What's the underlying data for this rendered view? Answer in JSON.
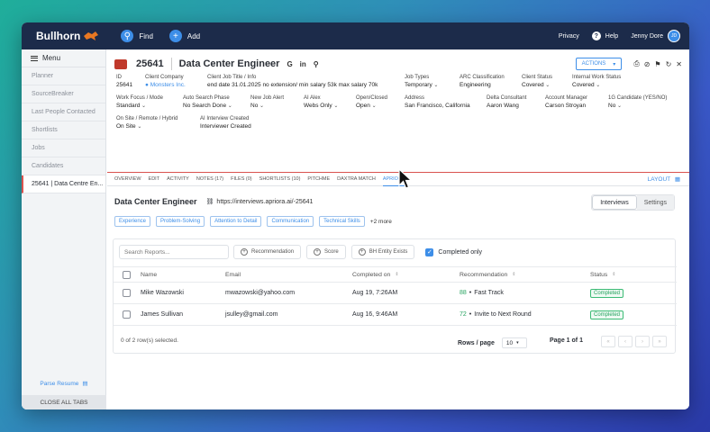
{
  "topbar": {
    "brand": "Bullhorn",
    "find": "Find",
    "add": "Add",
    "privacy": "Privacy",
    "help": "Help",
    "user": "Jenny Dore",
    "user_initials": "JD"
  },
  "sidebar": {
    "menu_label": "Menu",
    "items": [
      {
        "label": "Planner"
      },
      {
        "label": "SourceBreaker"
      },
      {
        "label": "Last People Contacted"
      },
      {
        "label": "Shortlists"
      },
      {
        "label": "Jobs"
      },
      {
        "label": "Candidates"
      },
      {
        "label": "25641 | Data Centre En..."
      }
    ],
    "parse_resume": "Parse Resume",
    "close_all": "CLOSE ALL TABS"
  },
  "record": {
    "id": "25641",
    "title": "Data Center Engineer",
    "links": [
      "G",
      "in"
    ],
    "actions_label": "ACTIONS"
  },
  "fields": {
    "row1": [
      {
        "label": "ID",
        "value": "25641"
      },
      {
        "label": "Client Company",
        "value": "Monsters Inc."
      },
      {
        "label": "Client Job Title / Info",
        "value": "end date 31.01.2025 no extension/ min salary 53k max salary 70k"
      },
      {
        "label": "Job Types",
        "value": "Temporary"
      },
      {
        "label": "ARC Classification",
        "value": "Engineering"
      },
      {
        "label": "Client Status",
        "value": "Covered"
      },
      {
        "label": "Internal Work Status",
        "value": "Covered"
      }
    ],
    "row2": [
      {
        "label": "Work Focus / Mode",
        "value": "Standard"
      },
      {
        "label": "Auto Search Phase",
        "value": "No Search Done"
      },
      {
        "label": "New Job Alert",
        "value": "No"
      },
      {
        "label": "AI Alex",
        "value": "Webs Only"
      },
      {
        "label": "Open/Closed",
        "value": "Open"
      },
      {
        "label": "Address",
        "value": "San Francisco, California"
      },
      {
        "label": "Delta Consultant",
        "value": "Aaron Wang"
      },
      {
        "label": "Account Manager",
        "value": "Carson Stroyan"
      },
      {
        "label": "1G Candidate (YES/NO)",
        "value": "No"
      }
    ],
    "row3": [
      {
        "label": "On Site / Remote / Hybrid",
        "value": "On Site"
      },
      {
        "label": "AI Interview Created",
        "value": "Interviewer Created"
      }
    ]
  },
  "tabs": [
    "OVERVIEW",
    "EDIT",
    "ACTIVITY",
    "NOTES (17)",
    "FILES (0)",
    "SHORTLISTS (10)",
    "PITCHME",
    "DAXTRA MATCH",
    "APRIORA"
  ],
  "layout_label": "LAYOUT",
  "apriora": {
    "title": "Data Center Engineer",
    "url": "https://interviews.apriora.ai/-25641",
    "seg_interviews": "Interviews",
    "seg_settings": "Settings",
    "chips": [
      "Experience",
      "Problem-Solving",
      "Attention to Detail",
      "Communication",
      "Technical Skills"
    ],
    "more": "+2 more",
    "search_placeholder": "Search Reports...",
    "filters": [
      "Recommendation",
      "Score",
      "BH Entity Exists"
    ],
    "completed_only": "Completed only",
    "columns": [
      "Name",
      "Email",
      "Completed on",
      "Recommendation",
      "Status"
    ],
    "rows": [
      {
        "name": "Mike Wazowski",
        "email": "mwazowski@yahoo.com",
        "completed": "Aug 19, 7:26AM",
        "score": "88",
        "rec": "Fast Track",
        "status": "Completed"
      },
      {
        "name": "James Sullivan",
        "email": "jsulley@gmail.com",
        "completed": "Aug 16, 9:46AM",
        "score": "72",
        "rec": "Invite to Next Round",
        "status": "Completed"
      }
    ],
    "selected_text": "0 of 2 row(s) selected.",
    "rows_per_page_label": "Rows / page",
    "rows_per_page": "10",
    "page_of": "Page 1 of 1"
  },
  "colors": {
    "accent": "#3d8ee8",
    "topbar": "#1c2b4a",
    "completed": "#27a360"
  }
}
